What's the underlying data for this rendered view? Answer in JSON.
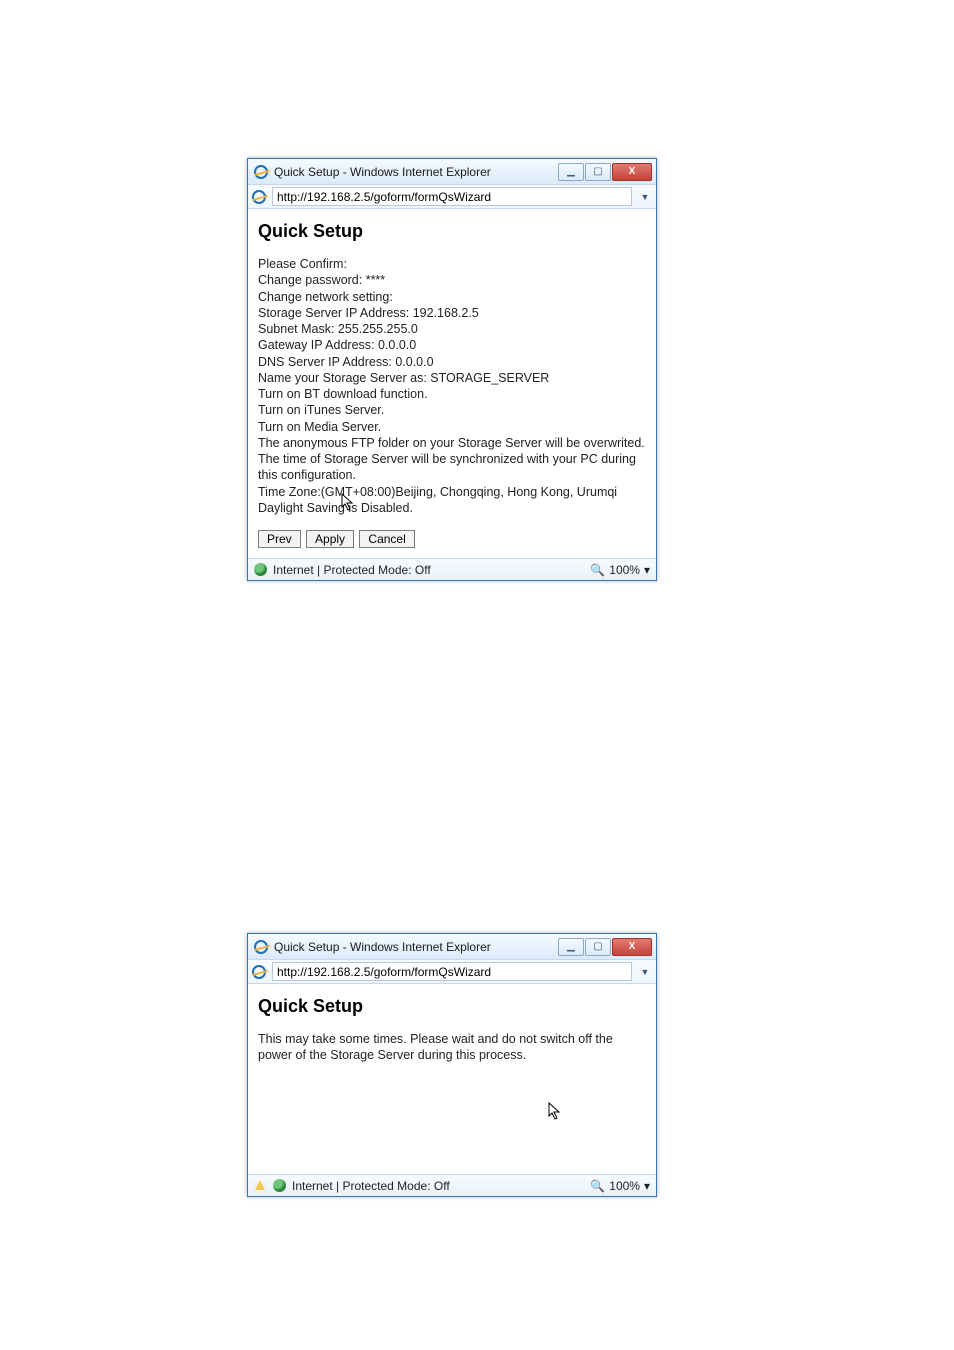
{
  "window1": {
    "title": "Quick Setup - Windows Internet Explorer",
    "url": "http://192.168.2.5/goform/formQsWizard",
    "heading": "Quick Setup",
    "lines": [
      "Please Confirm:",
      "Change password: ****",
      "Change network setting:",
      "Storage Server IP Address: 192.168.2.5",
      "Subnet Mask: 255.255.255.0",
      "Gateway IP Address: 0.0.0.0",
      "DNS Server IP Address: 0.0.0.0",
      "Name your Storage Server as: STORAGE_SERVER",
      "Turn on BT download function.",
      "Turn on iTunes Server.",
      "Turn on Media Server.",
      "The anonymous FTP folder on your Storage Server will be overwrited.",
      "The time of Storage Server will be synchronized with your PC during this configuration.",
      "Time Zone:(GMT+08:00)Beijing, Chongqing, Hong Kong, Urumqi",
      "Daylight Saving is Disabled."
    ],
    "buttons": {
      "prev": "Prev",
      "apply": "Apply",
      "cancel": "Cancel"
    },
    "status_text": "Internet | Protected Mode: Off",
    "zoom": "100%"
  },
  "window2": {
    "title": "Quick Setup - Windows Internet Explorer",
    "url": "http://192.168.2.5/goform/formQsWizard",
    "heading": "Quick Setup",
    "body": "This may take some times. Please wait and do not switch off the power of the Storage Server during this process.",
    "status_text": "Internet | Protected Mode: Off",
    "zoom": "100%"
  },
  "icons": {
    "minimize": "▁",
    "maximize": "▢",
    "close": "X",
    "dropdown": "▼",
    "zoom_dropdown": "▾"
  }
}
